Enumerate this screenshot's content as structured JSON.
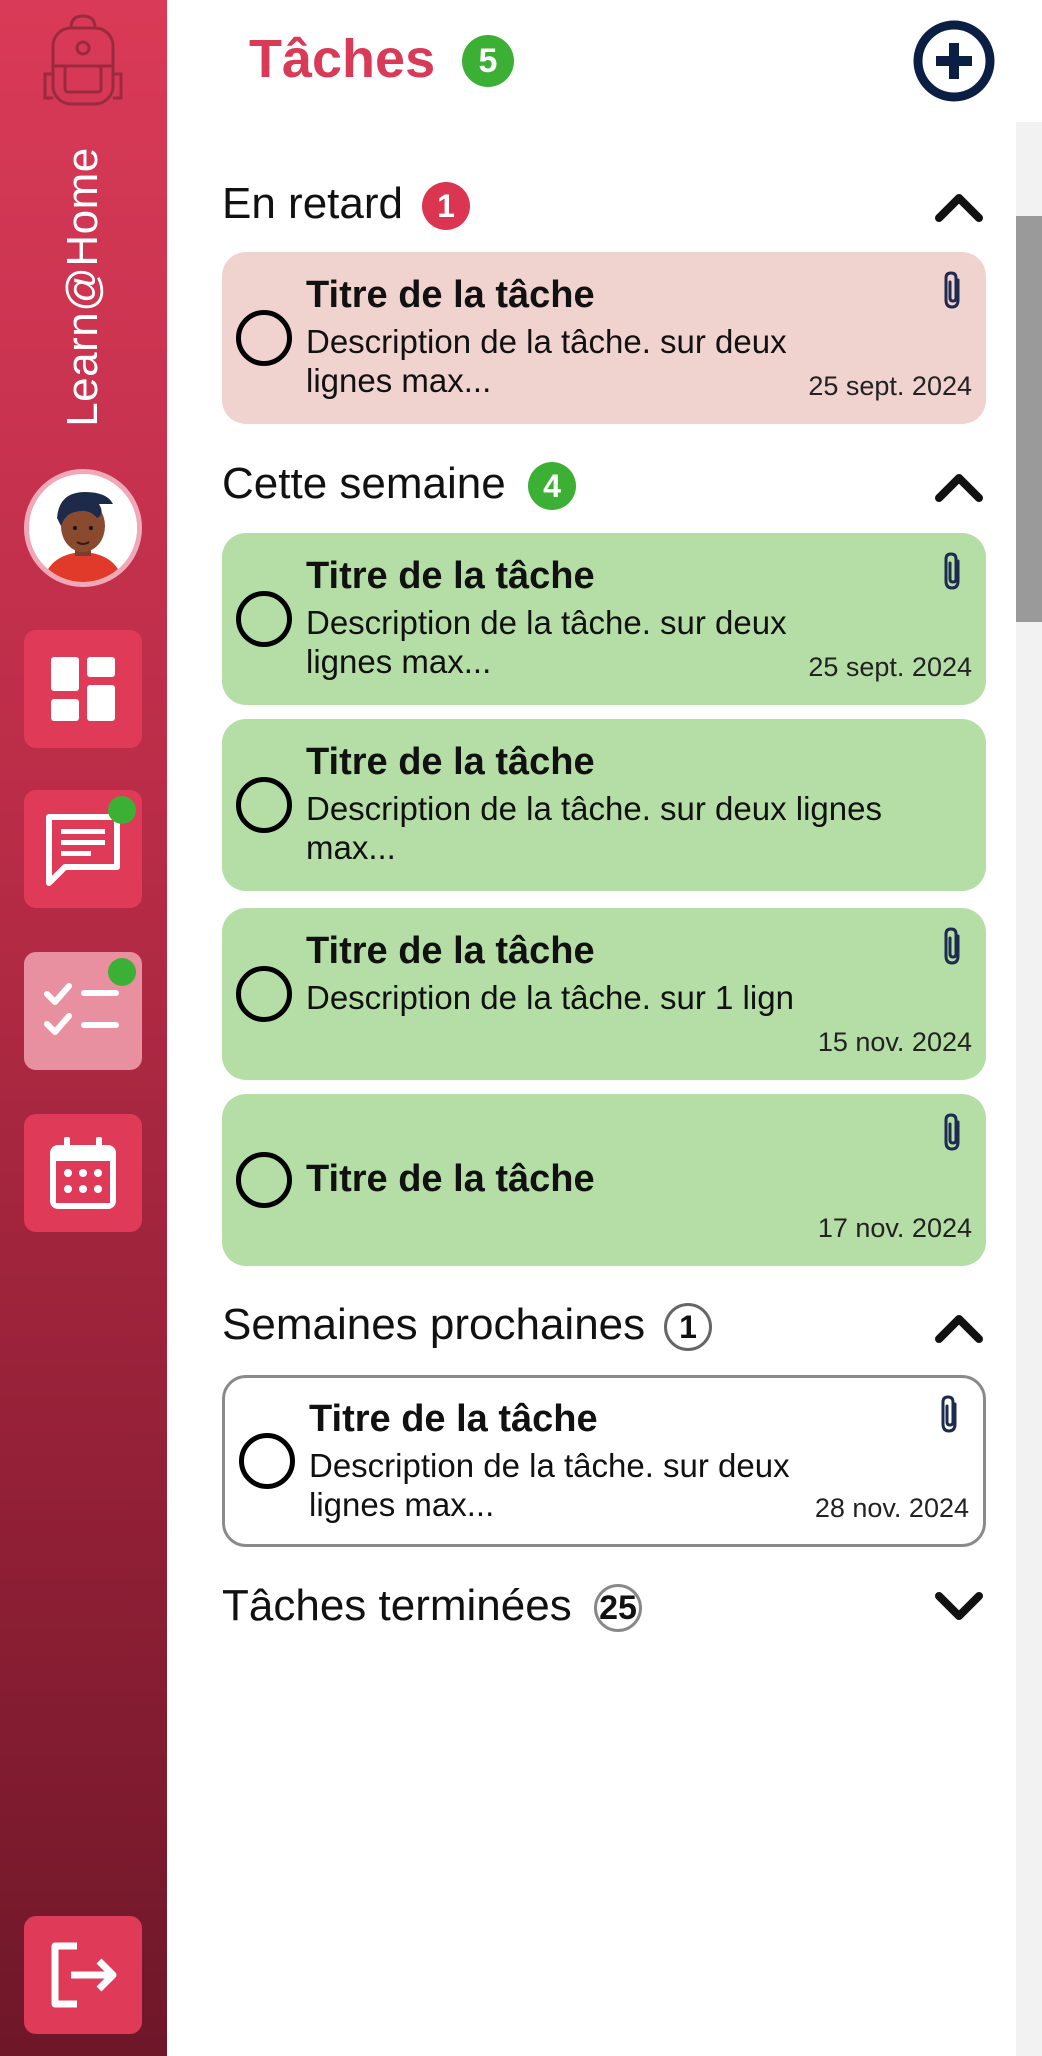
{
  "app": {
    "brand": "Learn@Home"
  },
  "header": {
    "title": "Tâches",
    "count": "5"
  },
  "sections": [
    {
      "title": "En retard",
      "count": "1",
      "expanded": true,
      "tasks": [
        {
          "title": "Titre de la tâche",
          "description": "Description de la tâche. sur deux lignes max...",
          "date": "25 sept. 2024",
          "attachment": true
        }
      ]
    },
    {
      "title": "Cette semaine",
      "count": "4",
      "expanded": true,
      "tasks": [
        {
          "title": "Titre de la tâche",
          "description": "Description de la tâche. sur deux lignes max...",
          "date": "25 sept. 2024",
          "attachment": true
        },
        {
          "title": "Titre de la tâche",
          "description": "Description de la tâche. sur deux  lignes max...",
          "date": "",
          "attachment": false
        },
        {
          "title": "Titre de la tâche",
          "description": "Description de la tâche. sur 1 lign",
          "date": "15 nov. 2024",
          "attachment": true
        },
        {
          "title": "Titre de la tâche",
          "description": "",
          "date": "17 nov. 2024",
          "attachment": true
        }
      ]
    },
    {
      "title": "Semaines prochaines",
      "count": "1",
      "expanded": true,
      "tasks": [
        {
          "title": "Titre de la tâche",
          "description": "Description de la tâche. sur deux lignes max...",
          "date": "28 nov. 2024",
          "attachment": true
        }
      ]
    },
    {
      "title": "Tâches terminées",
      "count": "25",
      "expanded": false,
      "tasks": []
    }
  ],
  "colors": {
    "brand_red": "#d93a57",
    "late_bg": "#f0d2cf",
    "week_bg": "#b5dea6",
    "badge_green": "#3bb034",
    "badge_red": "#dc3551"
  },
  "icons": {
    "sidebar": [
      "backpack-icon",
      "dashboard-icon",
      "messages-icon",
      "tasks-icon",
      "calendar-icon",
      "logout-icon"
    ],
    "header": [
      "add-circle-icon"
    ],
    "card": [
      "paperclip-icon"
    ]
  }
}
